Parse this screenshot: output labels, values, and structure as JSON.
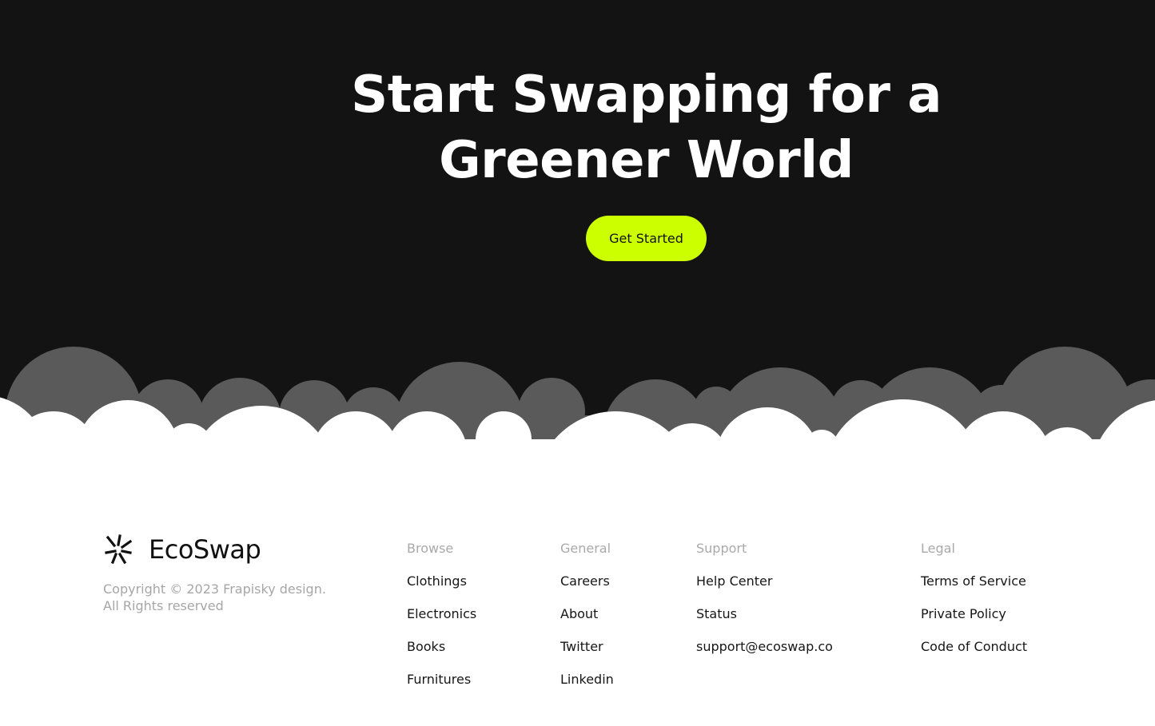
{
  "hero": {
    "title_line1": "Start Swapping for a",
    "title_line2": "Greener World",
    "cta_label": "Get Started"
  },
  "brand": {
    "name": "EcoSwap",
    "icon": "ecoswap-pinwheel-logo",
    "copyright_line1": "Copyright © 2023 Frapisky design.",
    "copyright_line2": "All Rights reserved"
  },
  "footer": {
    "columns": [
      {
        "heading": "Browse",
        "links": [
          "Clothings",
          "Electronics",
          "Books",
          "Furnitures"
        ]
      },
      {
        "heading": "General",
        "links": [
          "Careers",
          "About",
          "Twitter",
          "Linkedin"
        ]
      },
      {
        "heading": "Support",
        "links": [
          "Help Center",
          "Status",
          "support@ecoswap.co"
        ]
      },
      {
        "heading": "Legal",
        "links": [
          "Terms of Service",
          "Private Policy",
          "Code of Conduct"
        ]
      }
    ]
  },
  "colors": {
    "hero_bg": "#131313",
    "accent": "#ccff00",
    "cloud_back": "#5a5a5a",
    "cloud_front": "#ffffff",
    "muted_text": "#a9a9a9"
  }
}
